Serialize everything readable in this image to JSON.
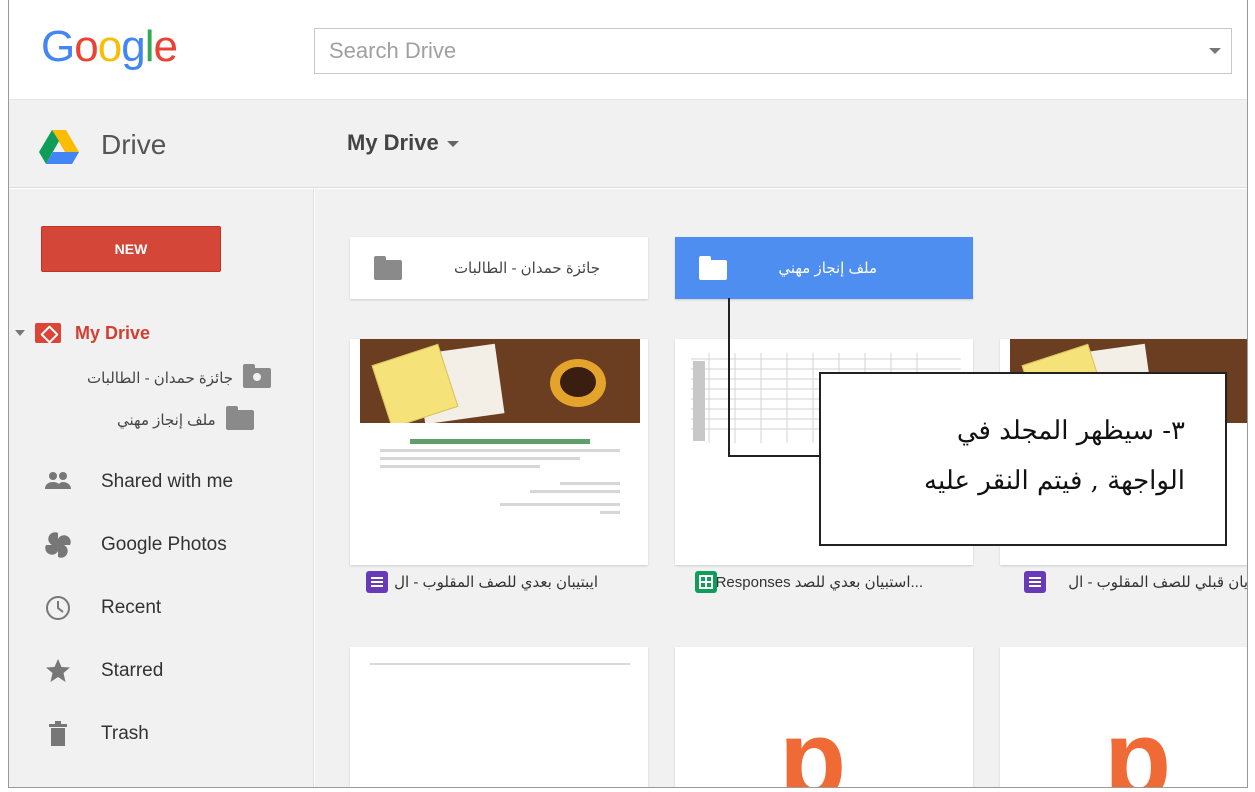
{
  "brand": {
    "logo_letters": [
      "G",
      "o",
      "o",
      "g",
      "l",
      "e"
    ],
    "logo_colors": [
      "#4285f4",
      "#ea4335",
      "#fbbc05",
      "#4285f4",
      "#34a853",
      "#ea4335"
    ]
  },
  "search": {
    "placeholder": "Search Drive"
  },
  "subbar": {
    "app_label": "Drive",
    "breadcrumb": "My Drive"
  },
  "sidebar": {
    "new_label": "NEW",
    "my_drive_label": "My Drive",
    "sub_folders": [
      {
        "label": "جائزة حمدان - الطالبات",
        "icon": "shared-folder-icon"
      },
      {
        "label": "ملف إنجاز مهني",
        "icon": "folder-icon"
      }
    ],
    "nav": [
      {
        "label": "Shared with me",
        "icon": "shared-people-icon"
      },
      {
        "label": "Google Photos",
        "icon": "pinwheel-icon"
      },
      {
        "label": "Recent",
        "icon": "clock-icon"
      },
      {
        "label": "Starred",
        "icon": "star-icon"
      },
      {
        "label": "Trash",
        "icon": "trash-icon"
      }
    ]
  },
  "folders": [
    {
      "label": "جائزة حمدان - الطالبات",
      "icon": "shared-folder-icon",
      "selected": false
    },
    {
      "label": "ملف إنجاز مهني",
      "icon": "folder-icon",
      "selected": true
    }
  ],
  "files": [
    {
      "caption": "ايبتيبان بعدي للصف المقلوب - ال",
      "type_icon": "forms-icon",
      "type_color": "#673ab7"
    },
    {
      "caption": "...استبيان بعدي للصد Responses)",
      "type_icon": "sheets-icon",
      "type_color": "#0f9d58"
    },
    {
      "caption": "يان قبلي للصف المقلوب - ال",
      "type_icon": "forms-icon",
      "type_color": "#673ab7"
    }
  ],
  "callout": {
    "line1": "٣- سيظهر المجلد في",
    "line2": "الواجهة , فيتم النقر عليه"
  },
  "colors": {
    "new_button": "#d44638",
    "selected_folder": "#4d8ef0",
    "my_drive_red": "#d23f31",
    "preview_orange": "#f06a35"
  }
}
